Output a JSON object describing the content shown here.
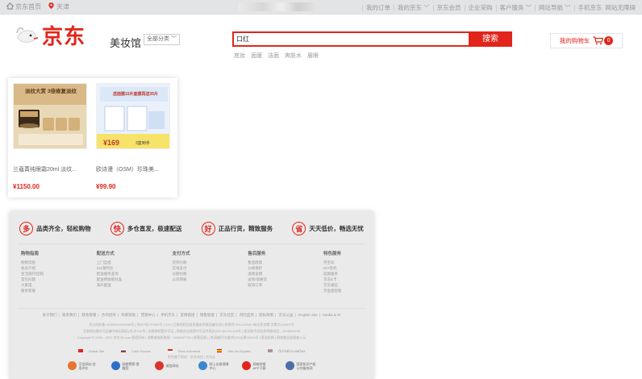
{
  "topbar": {
    "home": "京东首页",
    "location": "天津",
    "links": [
      "我的订单",
      "我的京东",
      "京东会员",
      "企业采购",
      "客户服务",
      "网站导航",
      "手机京东",
      "网站无障碍"
    ]
  },
  "header": {
    "brand": "京东",
    "channel": "美妆馆",
    "category_button": "全部分类",
    "search_value": "口红",
    "search_button": "搜索",
    "hotwords": [
      "底妆",
      "面膜",
      "洁面",
      "爽肤水",
      "眉眼"
    ],
    "cart_label": "我的购物车",
    "cart_count": "0"
  },
  "products": [
    {
      "name": "兰蔻菁纯眼霜20ml 淡纹...",
      "price": "¥1150.00",
      "thumb_text": "淡纹大赏 3倍修复淡纹"
    },
    {
      "name": "欧诗漫（OSM）珍珠美...",
      "price": "¥99.90",
      "thumb_text": "送面膜15片面膜再送35片",
      "thumb_price": "¥169",
      "thumb_sub": "3盒到手"
    }
  ],
  "footer": {
    "pledges": [
      {
        "icon": "多",
        "text": "品类齐全，轻松购物"
      },
      {
        "icon": "快",
        "text": "多仓直发，极速配送"
      },
      {
        "icon": "好",
        "text": "正品行货，精致服务"
      },
      {
        "icon": "省",
        "text": "天天低价，畅选无忧"
      }
    ],
    "columns": [
      {
        "title": "购物指南",
        "items": [
          "购物流程",
          "会员介绍",
          "生活旅行/团购",
          "常见问题",
          "大家电",
          "联系客服"
        ]
      },
      {
        "title": "配送方式",
        "items": [
          "上门自提",
          "211限时达",
          "配送服务查询",
          "配送费收取标准",
          "海外配送"
        ]
      },
      {
        "title": "支付方式",
        "items": [
          "货到付款",
          "在线支付",
          "分期付款",
          "公司转账"
        ]
      },
      {
        "title": "售后服务",
        "items": [
          "售后政策",
          "价格保护",
          "退款说明",
          "返修/退换货",
          "取消订单"
        ]
      },
      {
        "title": "特色服务",
        "items": [
          "夺宝岛",
          "DIY装机",
          "延保服务",
          "京东E卡",
          "京东通信",
          "京鱼座智能"
        ]
      }
    ],
    "links": [
      "关于我们",
      "联系我们",
      "联系客服",
      "合作招商",
      "商家帮助",
      "营销中心",
      "手机京东",
      "友情链接",
      "销售联盟",
      "京东社区",
      "风险监测",
      "隐私政策",
      "京东公益",
      "English Site",
      "Media & IR"
    ],
    "legal": [
      "京公网安备 11000002000088号 | 京ICP证070359号 | ICP | 互联网药品信息服务资格证编号(京)-经营性-2014-0008 | 新出发京零 字第大120007号",
      "互联网出版许可证编号新出网证(京)字150号 | 出版物经营许可证 | 网络文化经营许可证京网文[2014]2148-348号 | 违法和不良信息举报电话：4006561155",
      "Copyright © 2004 - 2022 京东JD.com 版权所有 | 消费者维权热线：4006067733 | 经营证照 | (京)网械平台备字(2018)第00003号 | 营业执照 | 网络食品经营者公示"
    ],
    "sites": [
      "Global Site",
      "Сайт России",
      "Situs Indonesia",
      "Sitio de España",
      "เว็บไซต์ประเทศไทย"
    ],
    "extra_line": "京东旗下网站：京东钱包 | 京东云",
    "badges": [
      "可信网站 信用评价",
      "网络警察 提醒您",
      "诚信网站",
      "网上交易保障中心",
      "网络举报 APP下载",
      "国家知识产权 公共服务网"
    ]
  }
}
